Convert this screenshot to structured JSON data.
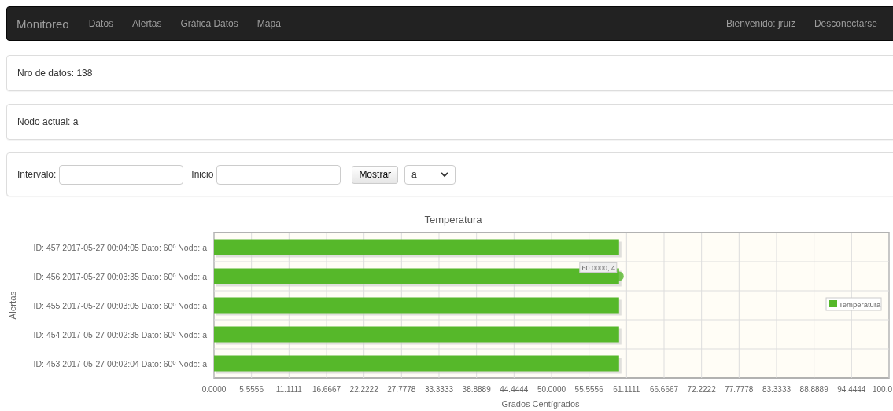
{
  "navbar": {
    "brand": "Monitoreo",
    "links": [
      "Datos",
      "Alertas",
      "Gráfica Datos",
      "Mapa"
    ],
    "user": "Bienvenido: jruiz",
    "logout": "Desconectarse"
  },
  "info_panels": [
    "Nro de datos: 138",
    "Nodo actual: a"
  ],
  "filter": {
    "interval_label": "Intervalo:",
    "start_label": "Inicio",
    "button": "Mostrar",
    "node_select": "a"
  },
  "chart": {
    "chart_data": {
      "type": "bar",
      "orientation": "horizontal",
      "title": "Temperatura",
      "xlabel": "Grados Centígrados",
      "ylabel": "Alertas",
      "categories": [
        "ID: 457 2017-05-27 00:04:05 Dato: 60º Nodo: a",
        "ID: 456 2017-05-27 00:03:35 Dato: 60º Nodo: a",
        "ID: 455 2017-05-27 00:03:05 Dato: 60º Nodo: a",
        "ID: 454 2017-05-27 00:02:35 Dato: 60º Nodo: a",
        "ID: 453 2017-05-27 00:02:04 Dato: 60º Nodo: a"
      ],
      "series": [
        {
          "name": "Temperatura",
          "color": "#56b82a",
          "values": [
            60,
            60,
            60,
            60,
            60
          ]
        }
      ],
      "xlim": [
        0,
        100
      ],
      "xticks": [
        {
          "value": 0,
          "label": "0.0000"
        },
        {
          "value": 5.5556,
          "label": "5.5556"
        },
        {
          "value": 11.1111,
          "label": "11.1111"
        },
        {
          "value": 16.6667,
          "label": "16.6667"
        },
        {
          "value": 22.2222,
          "label": "22.2222"
        },
        {
          "value": 27.7778,
          "label": "27.7778"
        },
        {
          "value": 33.3333,
          "label": "33.3333"
        },
        {
          "value": 38.8889,
          "label": "38.8889"
        },
        {
          "value": 44.4444,
          "label": "44.4444"
        },
        {
          "value": 50,
          "label": "50.0000"
        },
        {
          "value": 55.5556,
          "label": "55.5556"
        },
        {
          "value": 61.1111,
          "label": "61.1111"
        },
        {
          "value": 66.6667,
          "label": "66.6667"
        },
        {
          "value": 72.2222,
          "label": "72.2222"
        },
        {
          "value": 77.7778,
          "label": "77.7778"
        },
        {
          "value": 83.3333,
          "label": "83.3333"
        },
        {
          "value": 88.8889,
          "label": "88.8889"
        },
        {
          "value": 94.4444,
          "label": "94.4444"
        },
        {
          "value": 100,
          "label": "100.0"
        }
      ],
      "grid": true,
      "annotations": [
        {
          "x": 60,
          "y": "ID: 456 2017-05-27 00:03:35 Dato: 60º Nodo: a",
          "text": "60.0000, 4"
        }
      ]
    }
  }
}
